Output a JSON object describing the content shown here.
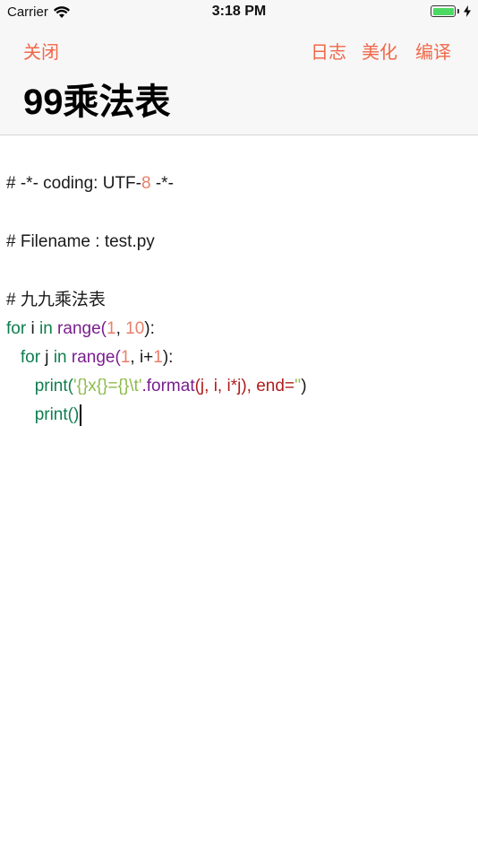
{
  "status_bar": {
    "carrier": "Carrier",
    "time": "3:18 PM",
    "battery_level": 1.0
  },
  "nav": {
    "close_label": "关闭",
    "log_label": "日志",
    "beautify_label": "美化",
    "compile_label": "编译"
  },
  "page_title": "99乘法表",
  "colors": {
    "accent": "#f0684a",
    "keyword": "#0f7d4f",
    "builtin": "#7a1e8e",
    "number": "#e8806a",
    "string": "#8dbb4a",
    "format_call": "#b01d1d",
    "battery_fill": "#4cd964"
  },
  "code": {
    "l1_a": "# -*- coding: UTF-",
    "l1_num": "8",
    "l1_b": " -*-",
    "l2": "# Filename : test.py",
    "l3": "# 九九乘法表",
    "l4_for": "for",
    "l4_i": " i ",
    "l4_in": "in",
    "l4_sp": " ",
    "l4_range": "range",
    "l4_paren": "(",
    "l4_n1": "1",
    "l4_comma": ", ",
    "l4_n2": "10",
    "l4_end": "):",
    "l5_indent": "   ",
    "l5_for": "for",
    "l5_j": " j ",
    "l5_in": "in",
    "l5_sp": " ",
    "l5_range": "range",
    "l5_paren": "(",
    "l5_n1": "1",
    "l5_mid": ", i+",
    "l5_n2": "1",
    "l5_end": "):",
    "l6_indent": "      ",
    "l6_print": "print",
    "l6_paren": "(",
    "l6_str": "'{}x{}={}\\t'",
    "l6_dot": ".",
    "l6_format": "format",
    "l6_args": "(j, i, i*j), end=",
    "l6_empty": "''",
    "l6_end": ")",
    "l7_indent": "      ",
    "l7_print": "print",
    "l7_parens": "()"
  }
}
